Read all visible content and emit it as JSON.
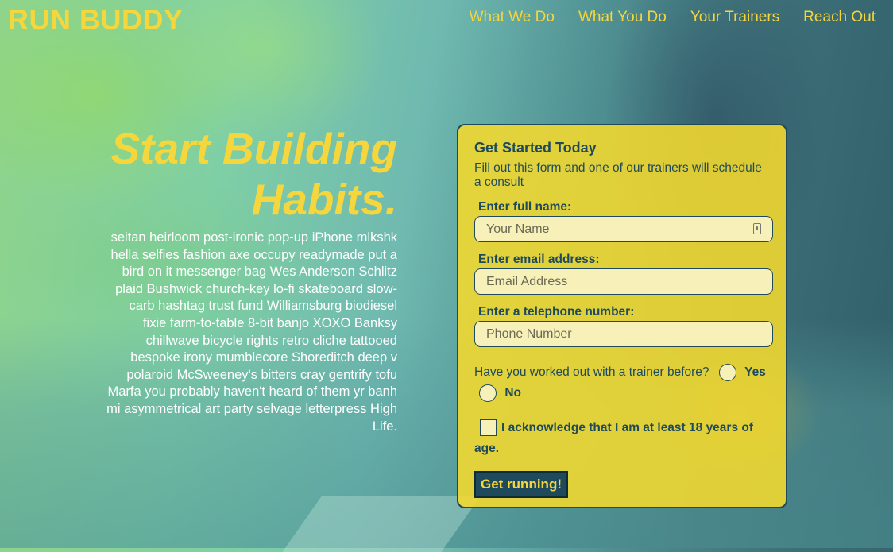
{
  "brand": {
    "name": "RUN BUDDY",
    "accent": "#f5d63d",
    "dark": "#1e4a5c"
  },
  "nav": {
    "items": [
      "What We Do",
      "What You Do",
      "Your Trainers",
      "Reach Out"
    ]
  },
  "hero": {
    "heading": "Start Building Habits.",
    "body": "seitan heirloom post-ironic pop-up iPhone mlkshk hella selfies fashion axe occupy readymade put a bird on it messenger bag Wes Anderson Schlitz plaid Bushwick church-key lo-fi skateboard slow-carb hashtag trust fund Williamsburg biodiesel fixie farm-to-table 8-bit banjo XOXO Banksy chillwave bicycle rights retro cliche tattooed bespoke irony mumblecore Shoreditch deep v polaroid McSweeney's bitters cray gentrify tofu Marfa you probably haven't heard of them yr banh mi asymmetrical art party selvage letterpress High Life."
  },
  "form": {
    "title": "Get Started Today",
    "description": "Fill out this form and one of our trainers will schedule a consult",
    "name": {
      "label": "Enter full name:",
      "placeholder": "Your Name",
      "value": ""
    },
    "email": {
      "label": "Enter email address:",
      "placeholder": "Email Address",
      "value": ""
    },
    "phone": {
      "label": "Enter a telephone number:",
      "placeholder": "Phone Number",
      "value": ""
    },
    "trainer_question": "Have you worked out with a trainer before?",
    "yes_label": "Yes",
    "no_label": "No",
    "age_ack": "I acknowledge that I am at least 18 years of age.",
    "submit_label": "Get running!",
    "autofill_icon": "contact-card-icon"
  }
}
